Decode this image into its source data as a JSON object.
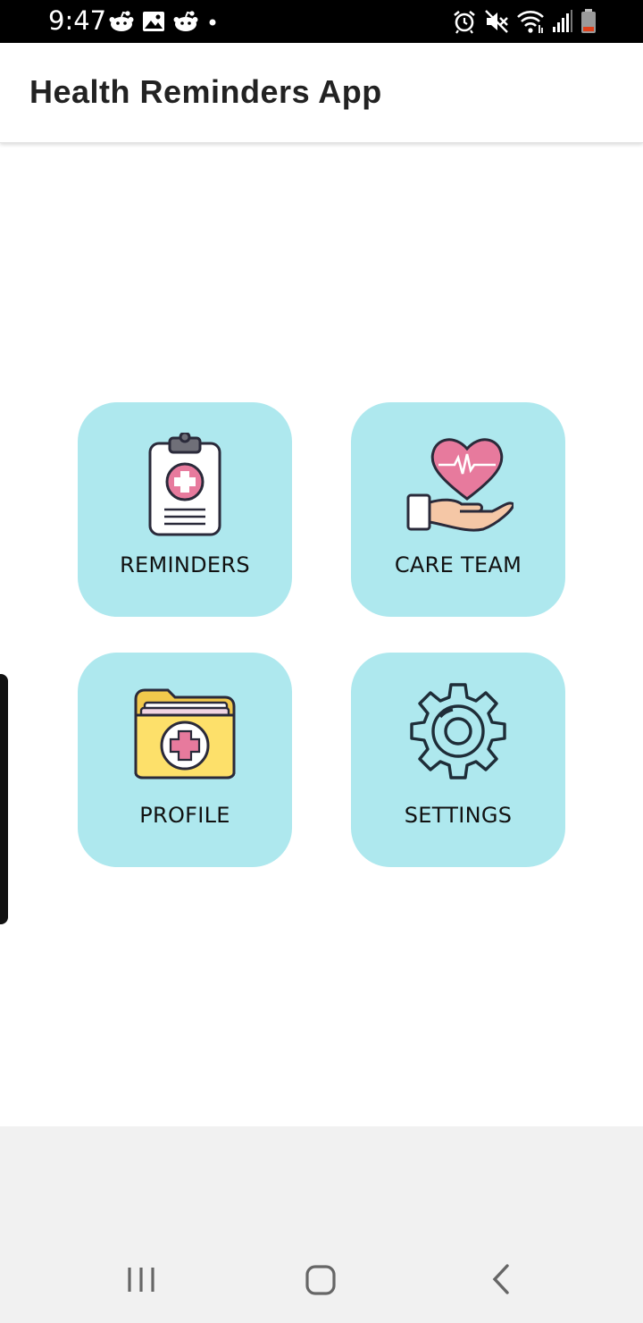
{
  "status_bar": {
    "time": "9:47",
    "left_icons": [
      "reddit-icon",
      "gallery-icon",
      "reddit-icon",
      "dot-icon"
    ],
    "right_icons": [
      "alarm-icon",
      "mute-icon",
      "wifi-icon",
      "signal-icon",
      "battery-icon"
    ]
  },
  "app_bar": {
    "title": "Health Reminders App"
  },
  "tiles": [
    {
      "label": "REMINDERS",
      "icon": "clipboard-medical-icon"
    },
    {
      "label": "CARE TEAM",
      "icon": "heart-hand-icon"
    },
    {
      "label": "PROFILE",
      "icon": "medical-folder-icon"
    },
    {
      "label": "SETTINGS",
      "icon": "gear-icon"
    }
  ],
  "nav_bar": {
    "buttons": [
      "recents-icon",
      "home-icon",
      "back-icon"
    ]
  },
  "colors": {
    "tile_background": "#aee8ee",
    "status_bar": "#000000",
    "nav_bar": "#f1f1f1",
    "accent_pink": "#e77a9d",
    "folder_yellow": "#fde06a"
  }
}
